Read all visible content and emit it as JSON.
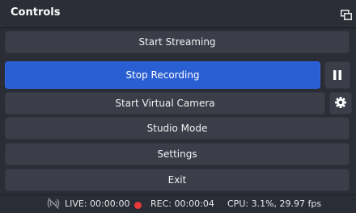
{
  "dock": {
    "title": "Controls",
    "float_icon": "float-window-icon"
  },
  "controls": {
    "start_streaming": "Start Streaming",
    "stop_recording": "Stop Recording",
    "pause_icon": "pause-icon",
    "start_virtual_camera": "Start Virtual Camera",
    "virtual_camera_settings_icon": "gear-icon",
    "studio_mode": "Studio Mode",
    "settings": "Settings",
    "exit": "Exit"
  },
  "status": {
    "live_icon": "broadcast-off-icon",
    "live": "LIVE: 00:00:00",
    "rec_indicator_color": "#e83a3a",
    "rec": "REC: 00:00:04",
    "cpu": "CPU: 3.1%, 29.97 fps"
  },
  "colors": {
    "accent": "#2a5fd4",
    "background": "#1f2027",
    "button": "#3b3d48"
  }
}
